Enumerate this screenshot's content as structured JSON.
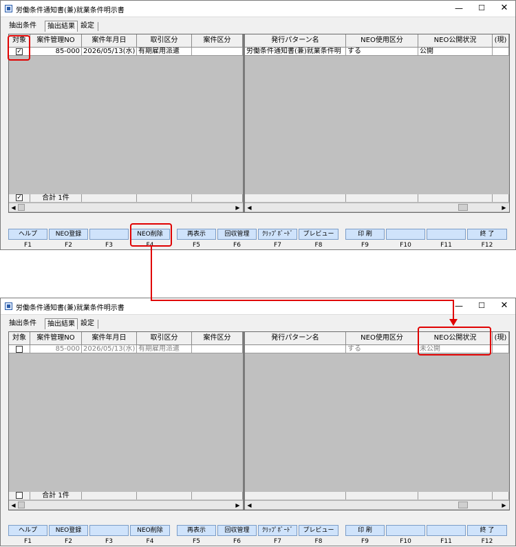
{
  "window": {
    "title": "労働条件通知書(兼)就業条件明示書",
    "minimize_glyph": "—",
    "maximize_glyph": "☐",
    "close_glyph": "✕"
  },
  "tabs": [
    "抽出条件",
    "抽出結果",
    "設定"
  ],
  "columns": [
    "対象",
    "案件管理NO",
    "案件年月日",
    "取引区分",
    "案件区分",
    "発行パターン名",
    "NEO使用区分",
    "NEO公開状況",
    "(現)"
  ],
  "top_row": {
    "checked": true,
    "check_glyph": "✓",
    "case_no": "85-000",
    "date": "2026/05/13(水)",
    "trade": "有期雇用派遣",
    "case_kind": "",
    "pattern": "労働条件通知書(兼)就業条件明",
    "neo_use": "する",
    "neo_status": "公開"
  },
  "bottom_row": {
    "checked": false,
    "case_no": "85-000",
    "date": "2026/05/13(水)",
    "trade": "有期雇用派遣",
    "case_kind": "",
    "pattern": "",
    "neo_use": "する",
    "neo_status": "未公開"
  },
  "footer": {
    "total": "合計 1件"
  },
  "scroll": {
    "left": "◀",
    "right": "▶"
  },
  "fkeys": [
    {
      "key": "F1",
      "label": "ヘルプ"
    },
    {
      "key": "F2",
      "label": "NEO登録"
    },
    {
      "key": "F3",
      "label": ""
    },
    {
      "key": "F4",
      "label": "NEO削除"
    },
    {
      "key": "F5",
      "label": "再表示"
    },
    {
      "key": "F6",
      "label": "回収管理"
    },
    {
      "key": "F7",
      "label": "ｸﾘｯﾌﾟﾎﾞｰﾄﾞ"
    },
    {
      "key": "F8",
      "label": "プレビュー"
    },
    {
      "key": "F9",
      "label": "印 刷"
    },
    {
      "key": "F10",
      "label": ""
    },
    {
      "key": "F11",
      "label": ""
    },
    {
      "key": "F12",
      "label": "終 了"
    }
  ],
  "colors": {
    "annotation": "#e00000",
    "fkey": "#cfe3fb",
    "grid_bg": "#c0c0c0"
  }
}
